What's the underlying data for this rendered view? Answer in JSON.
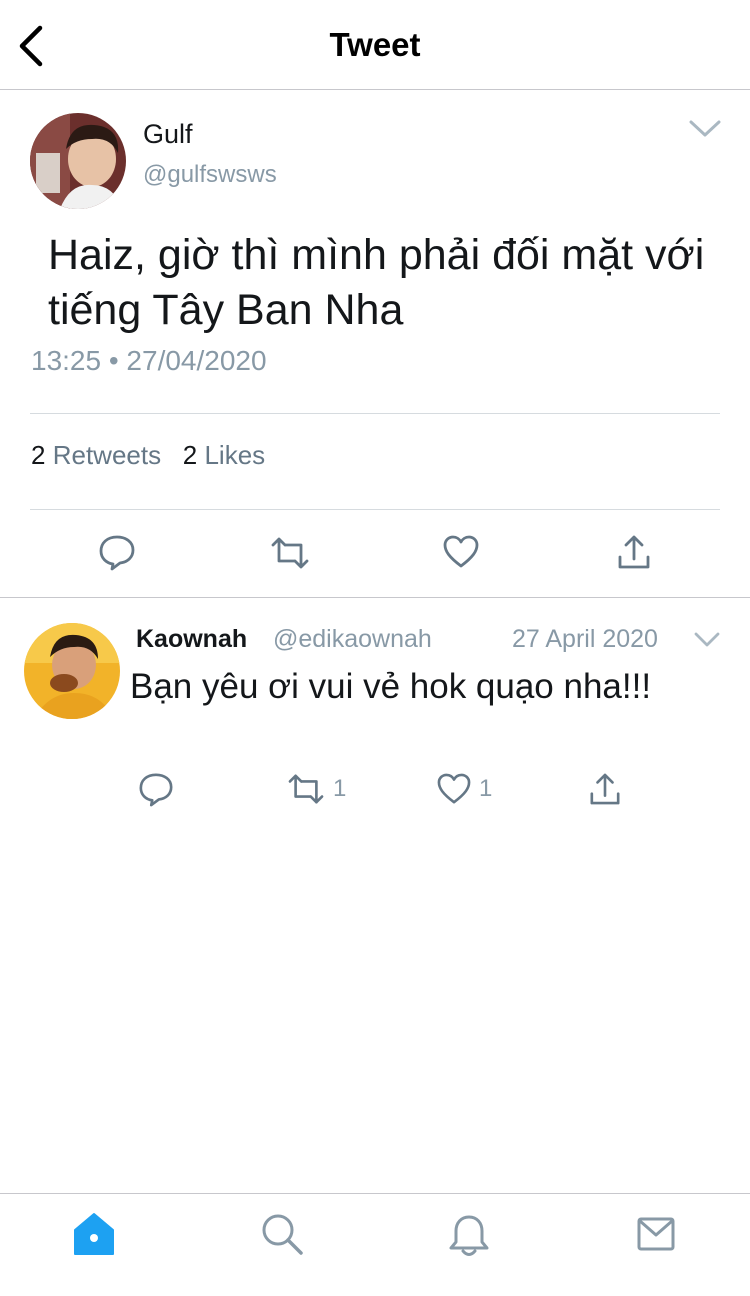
{
  "header": {
    "title": "Tweet"
  },
  "tweet": {
    "author_name": "Gulf",
    "author_handle": "@gulfswsws",
    "text": "Haiz, giờ thì mình phải đối mặt với tiếng Tây Ban Nha",
    "timestamp": "13:25 • 27/04/2020",
    "retweets_count": "2",
    "retweets_label": "Retweets",
    "likes_count": "2",
    "likes_label": "Likes"
  },
  "reply": {
    "author_name": "Kaownah",
    "author_handle": "@edikaownah",
    "date": "27 April 2020",
    "text": "Bạn yêu ơi vui vẻ hok quạo nha!!!",
    "retweet_count": "1",
    "like_count": "1"
  },
  "icons": [
    "back-icon",
    "chevron-down-icon",
    "reply-icon",
    "retweet-icon",
    "like-icon",
    "share-icon",
    "home-icon",
    "search-icon",
    "notifications-icon",
    "messages-icon"
  ],
  "colors": {
    "accent": "#1da1f2",
    "icon_gray": "#657786",
    "secondary_text": "#8899a6"
  }
}
